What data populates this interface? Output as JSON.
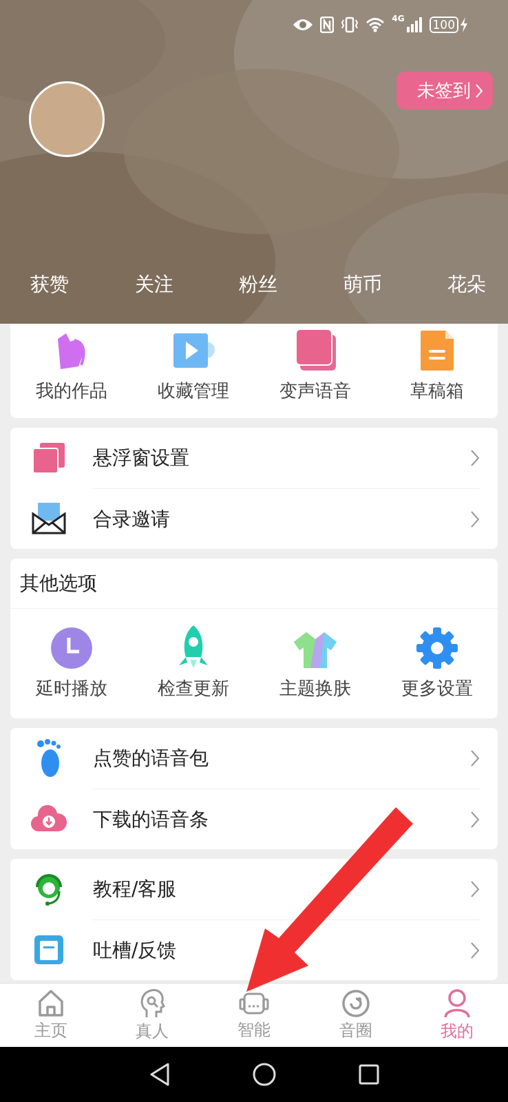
{
  "status_bar": {
    "network": "4G",
    "battery": "100"
  },
  "profile": {
    "checkin": "未签到",
    "stats": [
      "获赞",
      "关注",
      "粉丝",
      "萌币",
      "花朵"
    ]
  },
  "works": [
    "我的作品",
    "收藏管理",
    "变声语音",
    "草稿箱"
  ],
  "menu_1": [
    "悬浮窗设置",
    "合录邀请"
  ],
  "other_options": {
    "title": "其他选项",
    "items": [
      "延时播放",
      "检查更新",
      "主题换肤",
      "更多设置"
    ]
  },
  "menu_2": [
    "点赞的语音包",
    "下载的语音条"
  ],
  "menu_3": [
    "教程/客服",
    "吐槽/反馈"
  ],
  "tab_bar": [
    {
      "label": "主页",
      "selected": false
    },
    {
      "label": "真人",
      "selected": false
    },
    {
      "label": "智能",
      "selected": false
    },
    {
      "label": "音圈",
      "selected": false
    },
    {
      "label": "我的",
      "selected": true
    }
  ]
}
